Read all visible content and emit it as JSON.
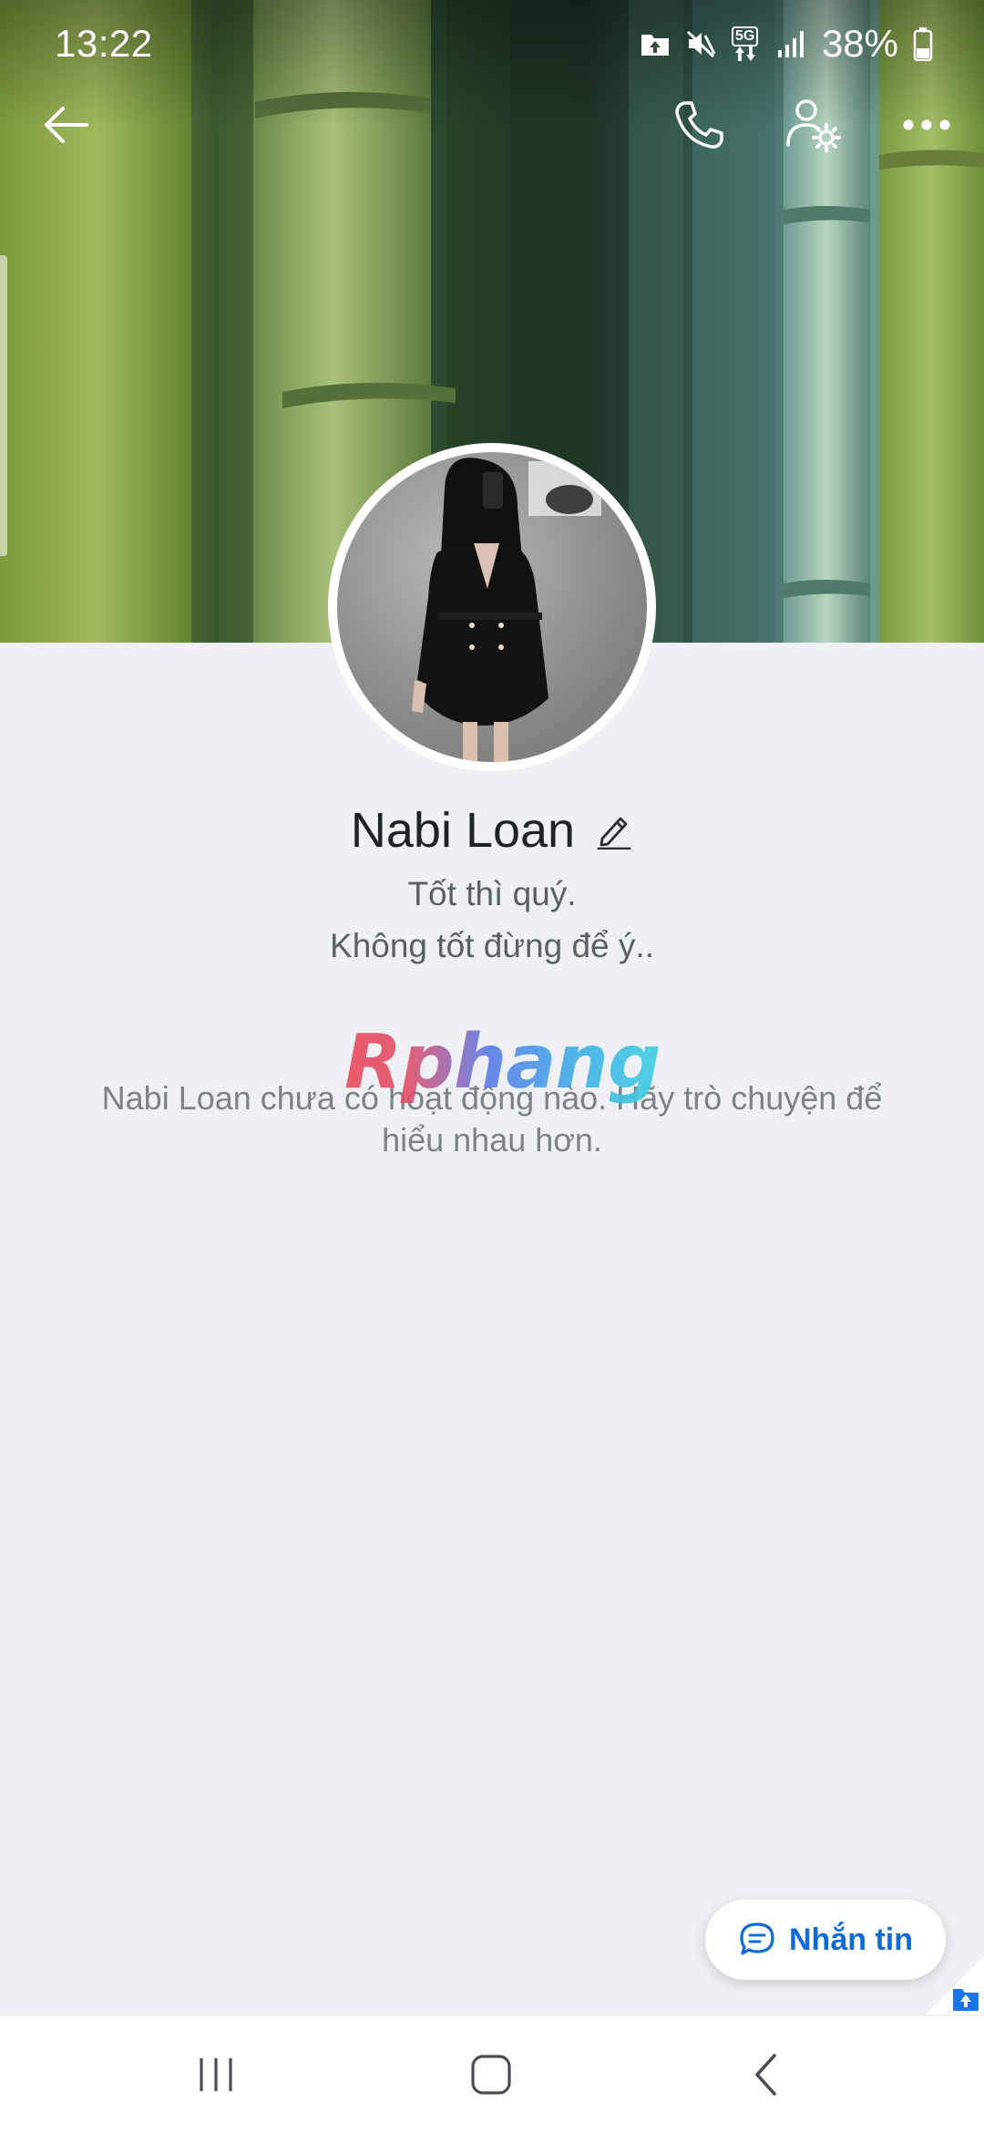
{
  "status_bar": {
    "time": "13:22",
    "network": "5G",
    "battery": "38%"
  },
  "app_bar": {
    "back_icon": "arrow-left-icon",
    "call_icon": "phone-icon",
    "settings_icon": "user-settings-icon",
    "more_icon": "more-horizontal-icon"
  },
  "profile": {
    "name": "Nabi Loan",
    "bio_line_1": "Tốt thì quý.",
    "bio_line_2": "Không tốt đừng để ý..",
    "empty_activity": "Nabi Loan chưa có hoạt động nào. Hãy trò chuyện để hiểu nhau hơn."
  },
  "watermark": "Rphang",
  "fab": {
    "label": "Nhắn tin",
    "icon": "chat-bubble-icon"
  },
  "colors": {
    "accent": "#0f6bd6",
    "background": "#eef0f4",
    "text_primary": "#1f2328",
    "text_secondary": "#5b6066",
    "text_muted": "#7d8288"
  },
  "nav_bar": {
    "recents_icon": "recents-icon",
    "home_icon": "home-icon",
    "back_icon": "nav-back-icon"
  }
}
